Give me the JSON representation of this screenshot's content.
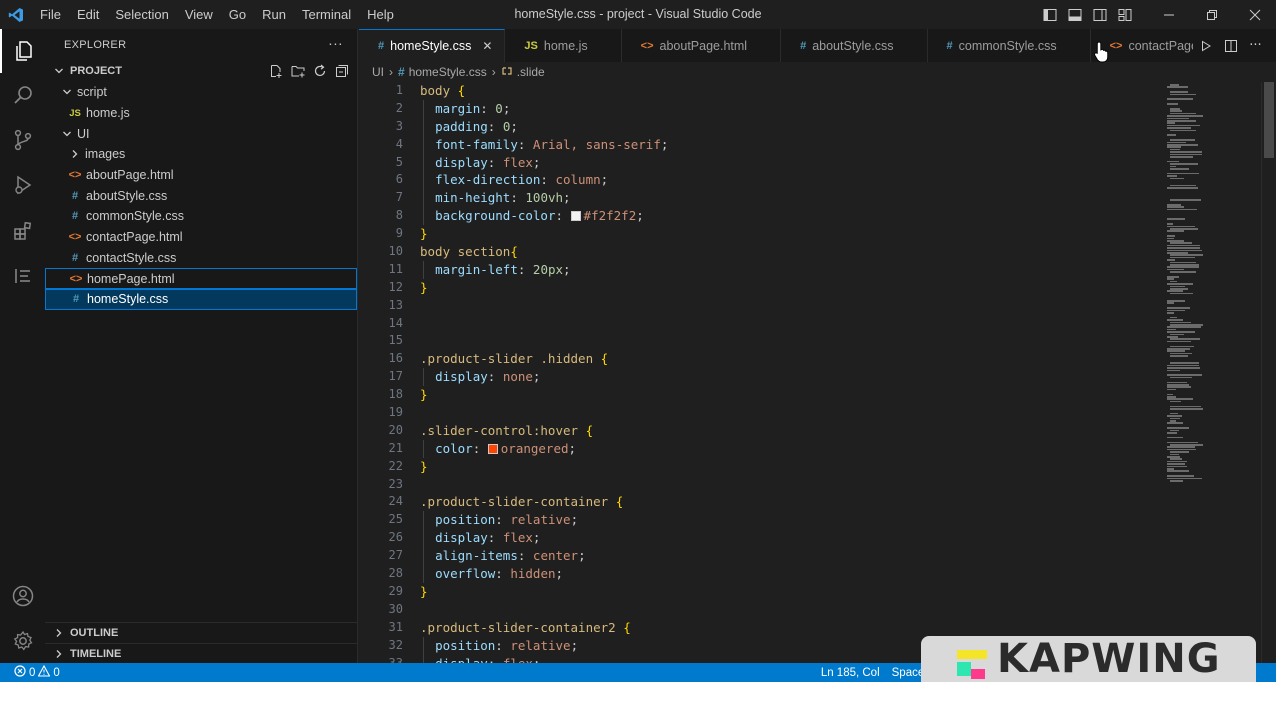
{
  "titlebar": {
    "menu": [
      "File",
      "Edit",
      "Selection",
      "View",
      "Go",
      "Run",
      "Terminal",
      "Help"
    ],
    "window_title": "homeStyle.css - project - Visual Studio Code"
  },
  "sidebar": {
    "header": "EXPLORER",
    "more": "···",
    "project": "PROJECT",
    "tree": [
      {
        "label": "script",
        "type": "folder",
        "depth": 1,
        "open": true
      },
      {
        "label": "home.js",
        "type": "js",
        "depth": 2
      },
      {
        "label": "UI",
        "type": "folder",
        "depth": 1,
        "open": true
      },
      {
        "label": "images",
        "type": "folder",
        "depth": 2,
        "open": false
      },
      {
        "label": "aboutPage.html",
        "type": "html",
        "depth": 2
      },
      {
        "label": "aboutStyle.css",
        "type": "css",
        "depth": 2
      },
      {
        "label": "commonStyle.css",
        "type": "css",
        "depth": 2
      },
      {
        "label": "contactPage.html",
        "type": "html",
        "depth": 2
      },
      {
        "label": "contactStyle.css",
        "type": "css",
        "depth": 2
      },
      {
        "label": "homePage.html",
        "type": "html",
        "depth": 2,
        "state": "focused"
      },
      {
        "label": "homeStyle.css",
        "type": "css",
        "depth": 2,
        "state": "selected"
      }
    ],
    "outline": "OUTLINE",
    "timeline": "TIMELINE"
  },
  "tabs": [
    {
      "label": "homeStyle.css",
      "type": "css",
      "active": true,
      "close": "✕"
    },
    {
      "label": "home.js",
      "type": "js"
    },
    {
      "label": "aboutPage.html",
      "type": "html"
    },
    {
      "label": "aboutStyle.css",
      "type": "css"
    },
    {
      "label": "commonStyle.css",
      "type": "css"
    },
    {
      "label": "contactPage.html",
      "type": "html",
      "close": "✕"
    }
  ],
  "breadcrumb": {
    "folder": "UI",
    "file": "homeStyle.css",
    "symbol": ".slide"
  },
  "code_lines": [
    [
      [
        "sel",
        "body"
      ],
      [
        "pun",
        " "
      ],
      [
        "br",
        "{"
      ]
    ],
    [
      [
        "pun",
        "  "
      ],
      [
        "prop",
        "margin"
      ],
      [
        "pun",
        ": "
      ],
      [
        "num",
        "0"
      ],
      [
        "pun",
        ";"
      ]
    ],
    [
      [
        "pun",
        "  "
      ],
      [
        "prop",
        "padding"
      ],
      [
        "pun",
        ": "
      ],
      [
        "num",
        "0"
      ],
      [
        "pun",
        ";"
      ]
    ],
    [
      [
        "pun",
        "  "
      ],
      [
        "prop",
        "font-family"
      ],
      [
        "pun",
        ": "
      ],
      [
        "val",
        "Arial, sans-serif"
      ],
      [
        "pun",
        ";"
      ]
    ],
    [
      [
        "pun",
        "  "
      ],
      [
        "prop",
        "display"
      ],
      [
        "pun",
        ": "
      ],
      [
        "val",
        "flex"
      ],
      [
        "pun",
        ";"
      ]
    ],
    [
      [
        "pun",
        "  "
      ],
      [
        "prop",
        "flex-direction"
      ],
      [
        "pun",
        ": "
      ],
      [
        "val",
        "column"
      ],
      [
        "pun",
        ";"
      ]
    ],
    [
      [
        "pun",
        "  "
      ],
      [
        "prop",
        "min-height"
      ],
      [
        "pun",
        ": "
      ],
      [
        "num",
        "100vh"
      ],
      [
        "pun",
        ";"
      ]
    ],
    [
      [
        "pun",
        "  "
      ],
      [
        "prop",
        "background-color"
      ],
      [
        "pun",
        ": "
      ],
      [
        "swatch",
        "#f2f2f2"
      ],
      [
        "val",
        "#f2f2f2"
      ],
      [
        "pun",
        ";"
      ]
    ],
    [
      [
        "br",
        "}"
      ]
    ],
    [
      [
        "sel",
        "body section"
      ],
      [
        "br",
        "{"
      ]
    ],
    [
      [
        "pun",
        "  "
      ],
      [
        "prop",
        "margin-left"
      ],
      [
        "pun",
        ": "
      ],
      [
        "num",
        "20px"
      ],
      [
        "pun",
        ";"
      ]
    ],
    [
      [
        "br",
        "}"
      ]
    ],
    [],
    [],
    [],
    [
      [
        "sel",
        ".product-slider .hidden"
      ],
      [
        "pun",
        " "
      ],
      [
        "br",
        "{"
      ]
    ],
    [
      [
        "pun",
        "  "
      ],
      [
        "prop",
        "display"
      ],
      [
        "pun",
        ": "
      ],
      [
        "val",
        "none"
      ],
      [
        "pun",
        ";"
      ]
    ],
    [
      [
        "br",
        "}"
      ]
    ],
    [],
    [
      [
        "sel",
        ".slider-control:hover"
      ],
      [
        "pun",
        " "
      ],
      [
        "br",
        "{"
      ]
    ],
    [
      [
        "pun",
        "  "
      ],
      [
        "prop",
        "color"
      ],
      [
        "pun",
        ": "
      ],
      [
        "swatch",
        "#ff4500"
      ],
      [
        "val",
        "orangered"
      ],
      [
        "pun",
        ";"
      ]
    ],
    [
      [
        "br",
        "}"
      ]
    ],
    [],
    [
      [
        "sel",
        ".product-slider-container"
      ],
      [
        "pun",
        " "
      ],
      [
        "br",
        "{"
      ]
    ],
    [
      [
        "pun",
        "  "
      ],
      [
        "prop",
        "position"
      ],
      [
        "pun",
        ": "
      ],
      [
        "val",
        "relative"
      ],
      [
        "pun",
        ";"
      ]
    ],
    [
      [
        "pun",
        "  "
      ],
      [
        "prop",
        "display"
      ],
      [
        "pun",
        ": "
      ],
      [
        "val",
        "flex"
      ],
      [
        "pun",
        ";"
      ]
    ],
    [
      [
        "pun",
        "  "
      ],
      [
        "prop",
        "align-items"
      ],
      [
        "pun",
        ": "
      ],
      [
        "val",
        "center"
      ],
      [
        "pun",
        ";"
      ]
    ],
    [
      [
        "pun",
        "  "
      ],
      [
        "prop",
        "overflow"
      ],
      [
        "pun",
        ": "
      ],
      [
        "val",
        "hidden"
      ],
      [
        "pun",
        ";"
      ]
    ],
    [
      [
        "br",
        "}"
      ]
    ],
    [],
    [
      [
        "sel",
        ".product-slider-container2"
      ],
      [
        "pun",
        " "
      ],
      [
        "br",
        "{"
      ]
    ],
    [
      [
        "pun",
        "  "
      ],
      [
        "prop",
        "position"
      ],
      [
        "pun",
        ": "
      ],
      [
        "val",
        "relative"
      ],
      [
        "pun",
        ";"
      ]
    ],
    [
      [
        "pun",
        "  "
      ],
      [
        "prop",
        "display"
      ],
      [
        "pun",
        ": "
      ],
      [
        "val",
        "flex"
      ],
      [
        "pun",
        ";"
      ]
    ]
  ],
  "statusbar": {
    "errors": "0",
    "warnings": "0",
    "position": "Ln 185, Col",
    "spaces": "Spaces"
  },
  "watermark": "KAPWING",
  "colors": {
    "accent": "#0078d4",
    "statusbar": "#007acc",
    "selector": "#d7ba7d",
    "property": "#9cdcfe",
    "value": "#ce9178",
    "number": "#b5cea8",
    "bracket": "#ffd700"
  },
  "icons": {
    "activity": [
      "explorer-icon",
      "search-icon",
      "source-control-icon",
      "run-debug-icon",
      "extensions-icon",
      "outline-view-icon"
    ],
    "activity_bottom": [
      "account-icon",
      "settings-gear-icon"
    ]
  }
}
